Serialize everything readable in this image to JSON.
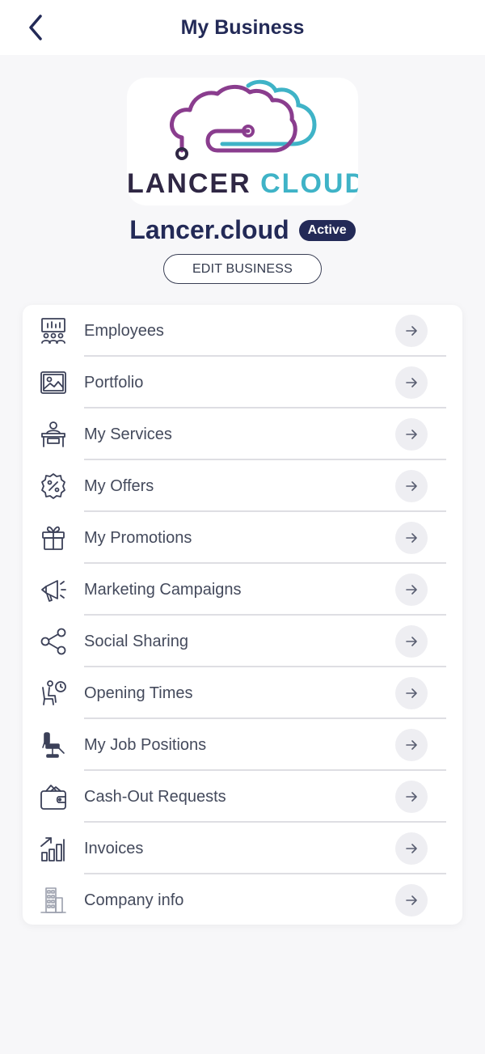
{
  "header": {
    "title": "My Business",
    "back_icon": "chevron-left-icon"
  },
  "logo": {
    "word1": "LANCER",
    "word2": "CLOUD",
    "colors": {
      "purple": "#8a3d8e",
      "teal": "#3fb3c7",
      "dark": "#2f2744"
    }
  },
  "business": {
    "name": "Lancer.cloud",
    "status": "Active",
    "edit_label": "EDIT BUSINESS"
  },
  "menu": {
    "items": [
      {
        "label": "Employees",
        "icon": "employees-icon"
      },
      {
        "label": "Portfolio",
        "icon": "image-icon"
      },
      {
        "label": "My Services",
        "icon": "desk-icon"
      },
      {
        "label": "My Offers",
        "icon": "discount-badge-icon"
      },
      {
        "label": "My Promotions",
        "icon": "gift-icon"
      },
      {
        "label": "Marketing Campaigns",
        "icon": "megaphone-icon"
      },
      {
        "label": "Social Sharing",
        "icon": "share-icon"
      },
      {
        "label": "Opening Times",
        "icon": "waiting-clock-icon"
      },
      {
        "label": "My Job Positions",
        "icon": "barber-chair-icon"
      },
      {
        "label": "Cash-Out Requests",
        "icon": "wallet-icon"
      },
      {
        "label": "Invoices",
        "icon": "growth-chart-icon"
      },
      {
        "label": "Company info",
        "icon": "building-icon"
      }
    ],
    "arrow_icon": "arrow-right-icon"
  },
  "colors": {
    "primary": "#232a57",
    "text": "#444a5c",
    "divider": "#dedee3",
    "arrow_bg": "#eeeef2",
    "background": "#f7f7f9"
  }
}
